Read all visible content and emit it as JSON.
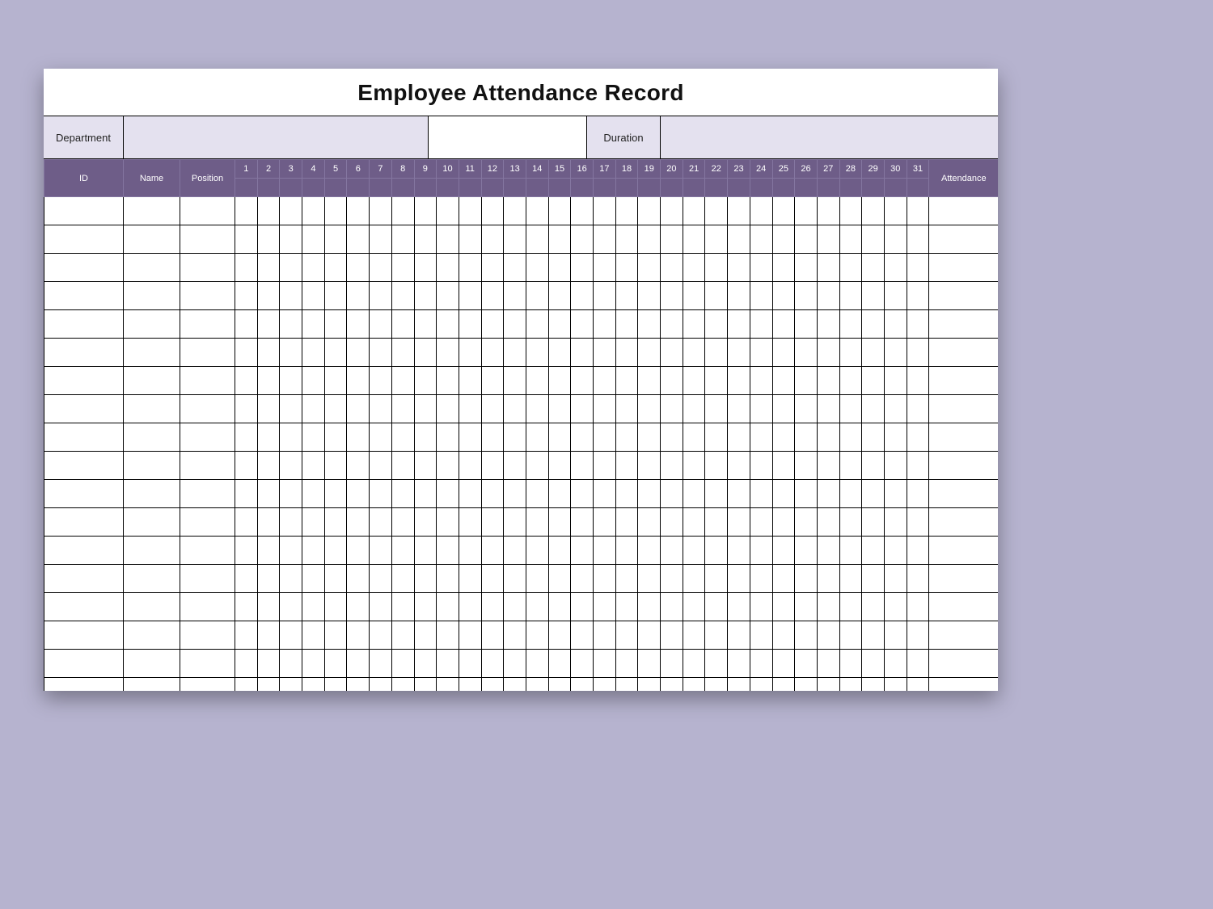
{
  "title": "Employee Attendance Record",
  "meta": {
    "department_label": "Department",
    "department_value": "",
    "duration_label": "Duration",
    "duration_value": ""
  },
  "columns": {
    "id": "ID",
    "name": "Name",
    "position": "Position",
    "attendance": "Attendance",
    "days": [
      "1",
      "2",
      "3",
      "4",
      "5",
      "6",
      "7",
      "8",
      "9",
      "10",
      "11",
      "12",
      "13",
      "14",
      "15",
      "16",
      "17",
      "18",
      "19",
      "20",
      "21",
      "22",
      "23",
      "24",
      "25",
      "26",
      "27",
      "28",
      "29",
      "30",
      "31"
    ]
  },
  "row_count": 18,
  "colors": {
    "background": "#b6b3cf",
    "header_fill": "#6e5d88",
    "meta_fill": "#e4e1ef"
  }
}
